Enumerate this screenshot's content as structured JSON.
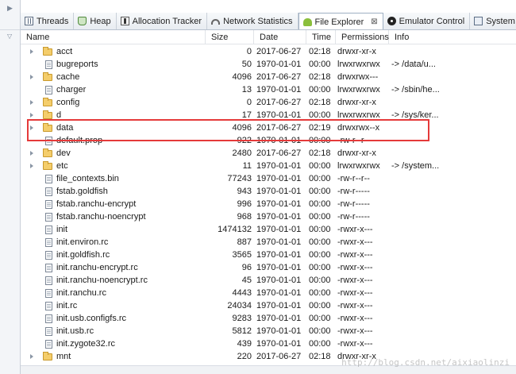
{
  "tabs": [
    {
      "label": "Threads",
      "icon": "threads-icon",
      "active": false
    },
    {
      "label": "Heap",
      "icon": "heap-icon",
      "active": false
    },
    {
      "label": "Allocation Tracker",
      "icon": "allocation-tracker-icon",
      "active": false
    },
    {
      "label": "Network Statistics",
      "icon": "network-statistics-icon",
      "active": false
    },
    {
      "label": "File Explorer",
      "icon": "android-icon",
      "active": true,
      "close": "⊠"
    },
    {
      "label": "Emulator Control",
      "icon": "emulator-control-icon",
      "active": false
    },
    {
      "label": "System Informati",
      "icon": "system-information-icon",
      "active": false
    }
  ],
  "columns": {
    "name": "Name",
    "size": "Size",
    "date": "Date",
    "time": "Time",
    "permissions": "Permissions",
    "info": "Info"
  },
  "rows": [
    {
      "name": "acct",
      "type": "folder",
      "size": "0",
      "date": "2017-06-27",
      "time": "02:18",
      "perm": "drwxr-xr-x",
      "info": ""
    },
    {
      "name": "bugreports",
      "type": "file",
      "size": "50",
      "date": "1970-01-01",
      "time": "00:00",
      "perm": "lrwxrwxrwx",
      "info": "-> /data/u..."
    },
    {
      "name": "cache",
      "type": "folder",
      "size": "4096",
      "date": "2017-06-27",
      "time": "02:18",
      "perm": "drwxrwx---",
      "info": ""
    },
    {
      "name": "charger",
      "type": "file",
      "size": "13",
      "date": "1970-01-01",
      "time": "00:00",
      "perm": "lrwxrwxrwx",
      "info": "-> /sbin/he..."
    },
    {
      "name": "config",
      "type": "folder",
      "size": "0",
      "date": "2017-06-27",
      "time": "02:18",
      "perm": "drwxr-xr-x",
      "info": ""
    },
    {
      "name": "d",
      "type": "folder",
      "size": "17",
      "date": "1970-01-01",
      "time": "00:00",
      "perm": "lrwxrwxrwx",
      "info": "-> /sys/ker..."
    },
    {
      "name": "data",
      "type": "folder",
      "size": "4096",
      "date": "2017-06-27",
      "time": "02:19",
      "perm": "drwxrwx--x",
      "info": ""
    },
    {
      "name": "default.prop",
      "type": "file",
      "size": "922",
      "date": "1970-01-01",
      "time": "00:00",
      "perm": "-rw-r--r--",
      "info": ""
    },
    {
      "name": "dev",
      "type": "folder",
      "size": "2480",
      "date": "2017-06-27",
      "time": "02:18",
      "perm": "drwxr-xr-x",
      "info": ""
    },
    {
      "name": "etc",
      "type": "folder",
      "size": "11",
      "date": "1970-01-01",
      "time": "00:00",
      "perm": "lrwxrwxrwx",
      "info": "-> /system..."
    },
    {
      "name": "file_contexts.bin",
      "type": "file",
      "size": "77243",
      "date": "1970-01-01",
      "time": "00:00",
      "perm": "-rw-r--r--",
      "info": ""
    },
    {
      "name": "fstab.goldfish",
      "type": "file",
      "size": "943",
      "date": "1970-01-01",
      "time": "00:00",
      "perm": "-rw-r-----",
      "info": ""
    },
    {
      "name": "fstab.ranchu-encrypt",
      "type": "file",
      "size": "996",
      "date": "1970-01-01",
      "time": "00:00",
      "perm": "-rw-r-----",
      "info": ""
    },
    {
      "name": "fstab.ranchu-noencrypt",
      "type": "file",
      "size": "968",
      "date": "1970-01-01",
      "time": "00:00",
      "perm": "-rw-r-----",
      "info": ""
    },
    {
      "name": "init",
      "type": "file",
      "size": "1474132",
      "date": "1970-01-01",
      "time": "00:00",
      "perm": "-rwxr-x---",
      "info": ""
    },
    {
      "name": "init.environ.rc",
      "type": "file",
      "size": "887",
      "date": "1970-01-01",
      "time": "00:00",
      "perm": "-rwxr-x---",
      "info": ""
    },
    {
      "name": "init.goldfish.rc",
      "type": "file",
      "size": "3565",
      "date": "1970-01-01",
      "time": "00:00",
      "perm": "-rwxr-x---",
      "info": ""
    },
    {
      "name": "init.ranchu-encrypt.rc",
      "type": "file",
      "size": "96",
      "date": "1970-01-01",
      "time": "00:00",
      "perm": "-rwxr-x---",
      "info": ""
    },
    {
      "name": "init.ranchu-noencrypt.rc",
      "type": "file",
      "size": "45",
      "date": "1970-01-01",
      "time": "00:00",
      "perm": "-rwxr-x---",
      "info": ""
    },
    {
      "name": "init.ranchu.rc",
      "type": "file",
      "size": "4443",
      "date": "1970-01-01",
      "time": "00:00",
      "perm": "-rwxr-x---",
      "info": ""
    },
    {
      "name": "init.rc",
      "type": "file",
      "size": "24034",
      "date": "1970-01-01",
      "time": "00:00",
      "perm": "-rwxr-x---",
      "info": ""
    },
    {
      "name": "init.usb.configfs.rc",
      "type": "file",
      "size": "9283",
      "date": "1970-01-01",
      "time": "00:00",
      "perm": "-rwxr-x---",
      "info": ""
    },
    {
      "name": "init.usb.rc",
      "type": "file",
      "size": "5812",
      "date": "1970-01-01",
      "time": "00:00",
      "perm": "-rwxr-x---",
      "info": ""
    },
    {
      "name": "init.zygote32.rc",
      "type": "file",
      "size": "439",
      "date": "1970-01-01",
      "time": "00:00",
      "perm": "-rwxr-x---",
      "info": ""
    },
    {
      "name": "mnt",
      "type": "folder",
      "size": "220",
      "date": "2017-06-27",
      "time": "02:18",
      "perm": "drwxr-xr-x",
      "info": ""
    }
  ],
  "highlight": {
    "row": "data",
    "color": "#e53a3a"
  },
  "watermark": "http://blog.csdn.net/aixiaolinzi",
  "colors": {
    "folder": "#f4cd6b",
    "highlight_border": "#e53a3a",
    "header_border": "#e1e4e8"
  }
}
